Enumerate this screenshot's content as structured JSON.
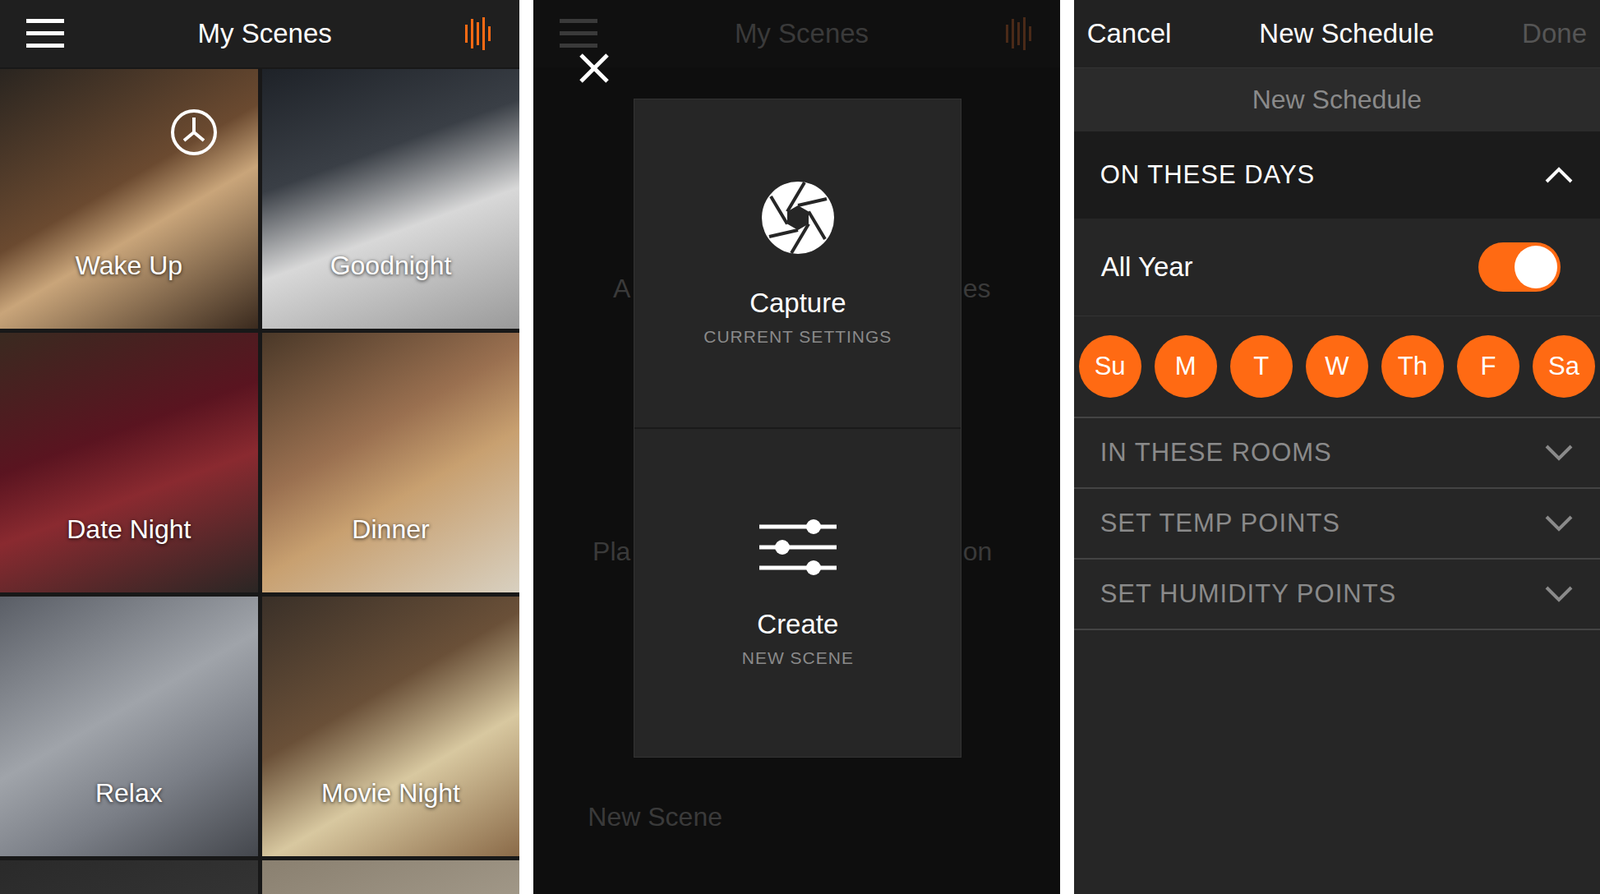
{
  "scenes_screen": {
    "title": "My Scenes",
    "scenes": [
      {
        "label": "Wake Up",
        "scheduled": true
      },
      {
        "label": "Goodnight",
        "scheduled": false
      },
      {
        "label": "Date Night",
        "scheduled": false
      },
      {
        "label": "Dinner",
        "scheduled": false
      },
      {
        "label": "Relax",
        "scheduled": false
      },
      {
        "label": "Movie Night",
        "scheduled": false
      }
    ]
  },
  "menu_screen": {
    "title": "My Scenes",
    "background_rows": [
      {
        "left": "A",
        "right": "es"
      },
      {
        "left": "Pla",
        "right": "on"
      }
    ],
    "background_caption": "New Scene",
    "options": [
      {
        "title": "Capture",
        "subtitle": "CURRENT SETTINGS",
        "kind": "capture"
      },
      {
        "title": "Create",
        "subtitle": "NEW SCENE",
        "kind": "create"
      }
    ]
  },
  "schedule_screen": {
    "cancel": "Cancel",
    "title": "New Schedule",
    "done": {
      "label": "Done",
      "disabled": true
    },
    "name_placeholder": "New Schedule",
    "sections": [
      {
        "label": "ON THESE DAYS",
        "expanded": true
      },
      {
        "label": "IN THESE ROOMS",
        "expanded": false
      },
      {
        "label": "SET TEMP POINTS",
        "expanded": false
      },
      {
        "label": "SET HUMIDITY POINTS",
        "expanded": false
      }
    ],
    "all_year": {
      "label": "All Year",
      "on": true
    },
    "days": [
      {
        "label": "Su",
        "selected": true
      },
      {
        "label": "M",
        "selected": true
      },
      {
        "label": "T",
        "selected": true
      },
      {
        "label": "W",
        "selected": true
      },
      {
        "label": "Th",
        "selected": true
      },
      {
        "label": "F",
        "selected": true
      },
      {
        "label": "Sa",
        "selected": true
      }
    ]
  }
}
